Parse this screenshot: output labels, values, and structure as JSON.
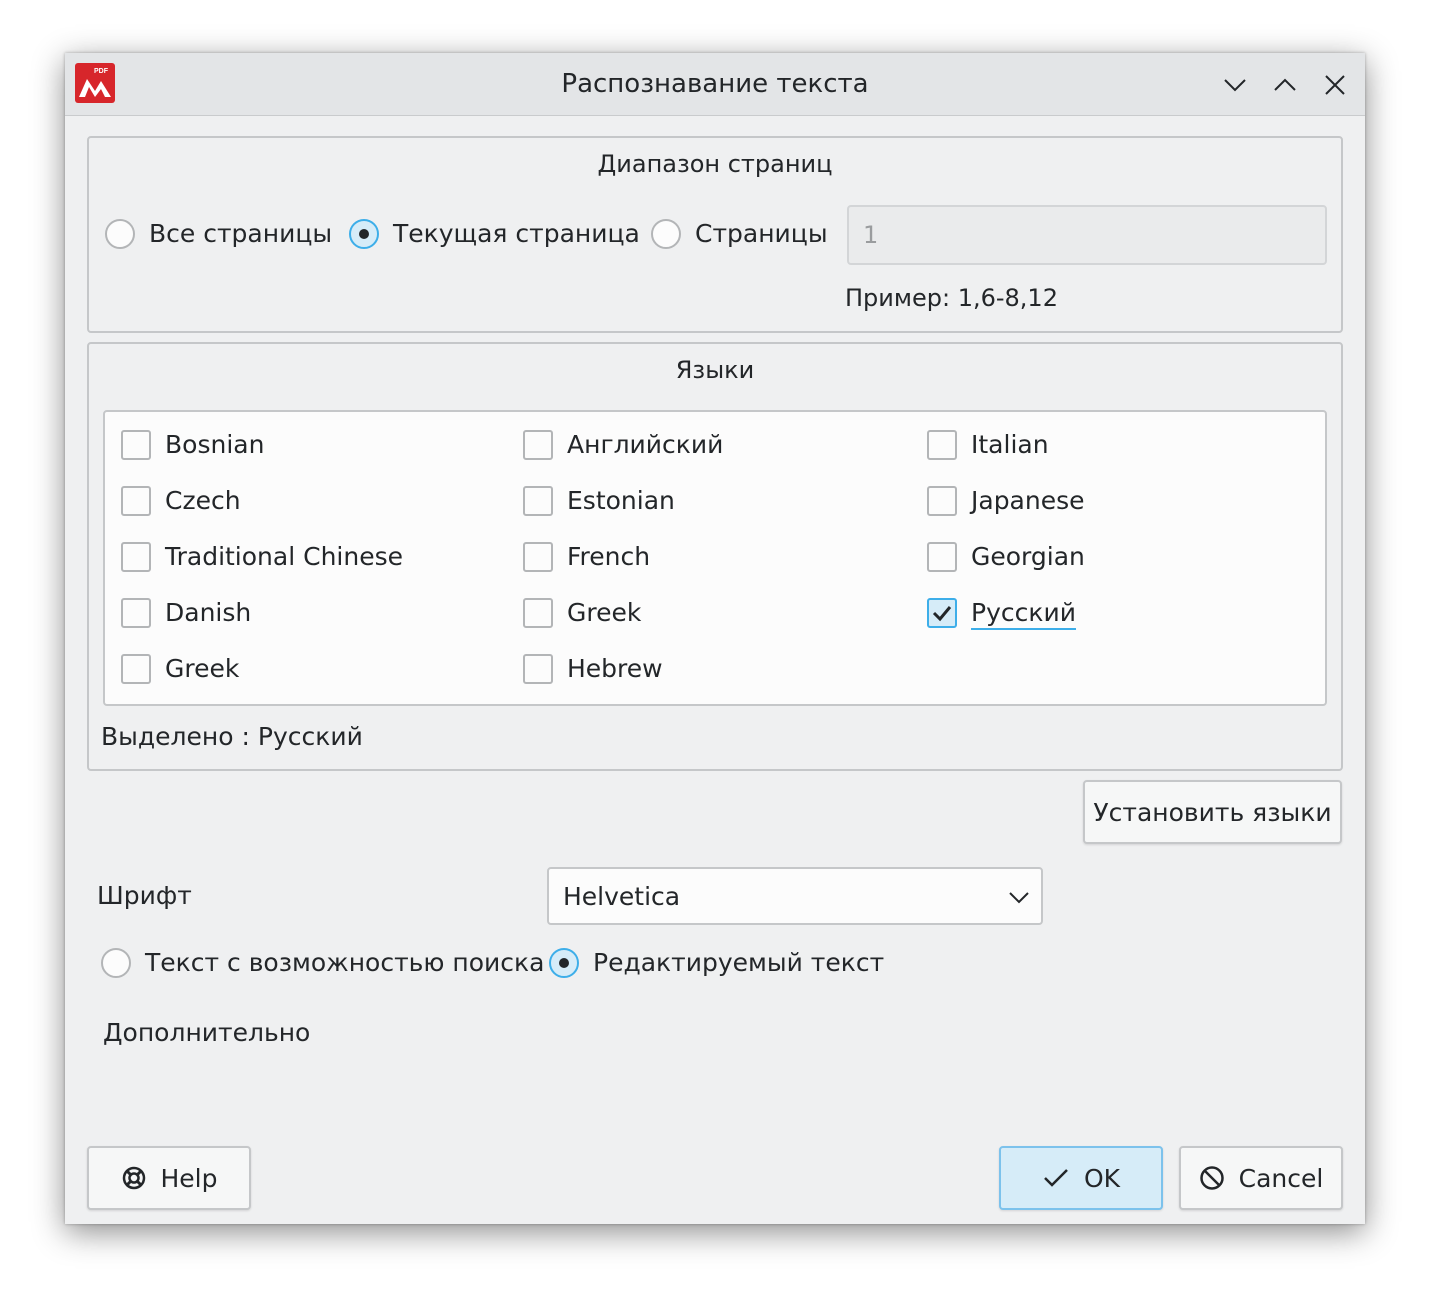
{
  "window": {
    "title": "Распознавание текста",
    "icon": "pdf-app-icon",
    "icon_text": "PDF",
    "controls": [
      "minimize-icon",
      "maximize-icon",
      "close-icon"
    ]
  },
  "page_range": {
    "title": "Диапазон страниц",
    "options": [
      {
        "label": "Все страницы",
        "selected": false
      },
      {
        "label": "Текущая страница",
        "selected": true
      },
      {
        "label": "Страницы",
        "selected": false
      }
    ],
    "pages_value": "1",
    "example": "Пример: 1,6-8,12"
  },
  "languages": {
    "title": "Языки",
    "columns": [
      [
        {
          "label": "Bosnian",
          "checked": false
        },
        {
          "label": "Czech",
          "checked": false
        },
        {
          "label": "Traditional Chinese",
          "checked": false
        },
        {
          "label": "Danish",
          "checked": false
        },
        {
          "label": "Greek",
          "checked": false
        }
      ],
      [
        {
          "label": "Английский",
          "checked": false
        },
        {
          "label": "Estonian",
          "checked": false
        },
        {
          "label": "French",
          "checked": false
        },
        {
          "label": "Greek",
          "checked": false
        },
        {
          "label": "Hebrew",
          "checked": false
        }
      ],
      [
        {
          "label": "Italian",
          "checked": false
        },
        {
          "label": "Japanese",
          "checked": false
        },
        {
          "label": "Georgian",
          "checked": false
        },
        {
          "label": "Русский",
          "checked": true
        }
      ]
    ],
    "selected_text": "Выделено : Русский",
    "install_button": "Установить языки"
  },
  "font": {
    "label": "Шрифт",
    "value": "Helvetica"
  },
  "text_mode": {
    "options": [
      {
        "label": "Текст с возможностью поиска",
        "selected": false
      },
      {
        "label": "Редактируемый текст",
        "selected": true
      }
    ]
  },
  "advanced_label": "Дополнительно",
  "buttons": {
    "help": "Help",
    "ok": "OK",
    "cancel": "Cancel"
  },
  "colors": {
    "accent": "#3daee9",
    "window_bg": "#eff0f1",
    "app_icon": "#d7262b"
  }
}
